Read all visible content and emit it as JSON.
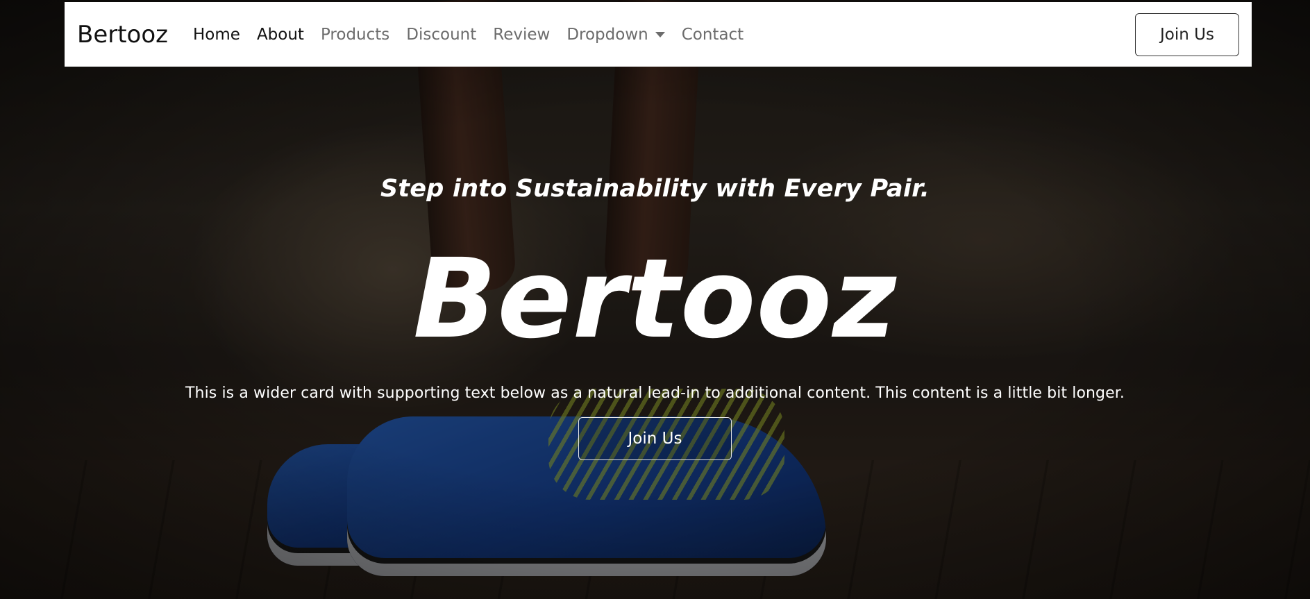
{
  "navbar": {
    "brand": "Bertooz",
    "links": [
      {
        "label": "Home"
      },
      {
        "label": "About"
      },
      {
        "label": "Products"
      },
      {
        "label": "Discount"
      },
      {
        "label": "Review"
      },
      {
        "label": "Dropdown"
      },
      {
        "label": "Contact"
      }
    ],
    "join_label": "Join Us"
  },
  "hero": {
    "tagline": "Step into Sustainability with Every Pair.",
    "title": "Bertooz",
    "lead": "This is a wider card with supporting text below as a natural lead-in to additional content. This content is a little bit longer.",
    "join_label": "Join Us"
  },
  "colors": {
    "navbar_bg": "#ffffff",
    "active_link": "#111111",
    "inactive_link": "#6c6c6c",
    "hero_text": "#ffffff"
  }
}
